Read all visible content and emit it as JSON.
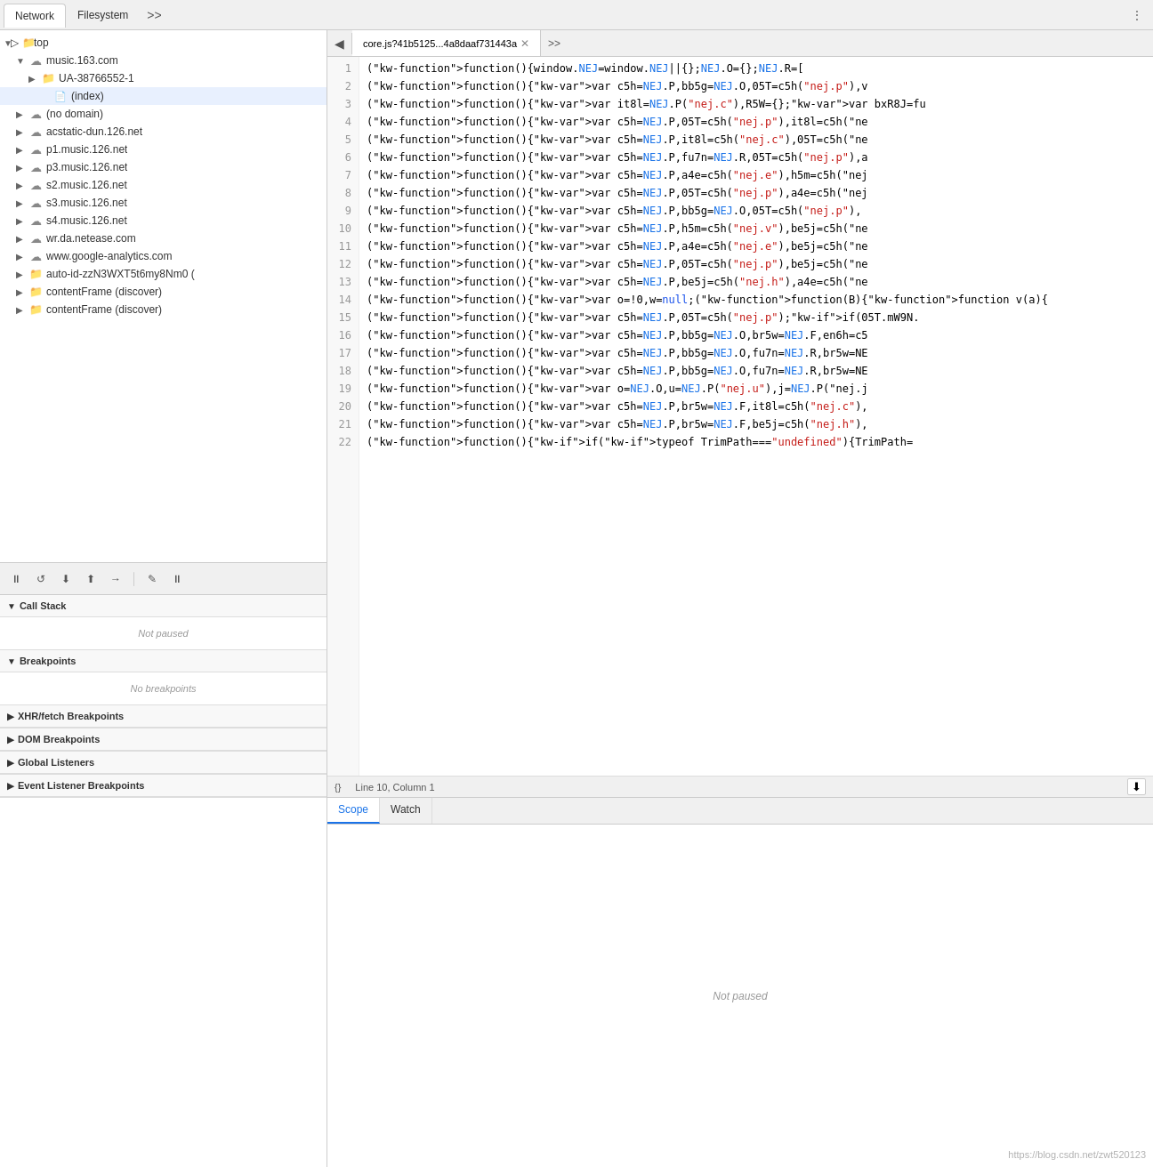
{
  "tabs": {
    "network_label": "Network",
    "filesystem_label": "Filesystem",
    "more_label": ">>",
    "dots": "⋮"
  },
  "file_tree": {
    "items": [
      {
        "id": "top",
        "label": "top",
        "indent": 0,
        "type": "arrow-folder",
        "expanded": true,
        "arrow": "▼"
      },
      {
        "id": "music163",
        "label": "music.163.com",
        "indent": 1,
        "type": "cloud",
        "expanded": true,
        "arrow": "▼"
      },
      {
        "id": "ua",
        "label": "UA-38766552-1",
        "indent": 2,
        "type": "folder",
        "expanded": false,
        "arrow": "▶"
      },
      {
        "id": "index",
        "label": "(index)",
        "indent": 3,
        "type": "file",
        "expanded": false,
        "arrow": "",
        "selected": true
      },
      {
        "id": "nodomain",
        "label": "(no domain)",
        "indent": 1,
        "type": "cloud",
        "expanded": false,
        "arrow": "▶"
      },
      {
        "id": "acstatic",
        "label": "acstatic-dun.126.net",
        "indent": 1,
        "type": "cloud",
        "expanded": false,
        "arrow": "▶"
      },
      {
        "id": "p1music",
        "label": "p1.music.126.net",
        "indent": 1,
        "type": "cloud",
        "expanded": false,
        "arrow": "▶"
      },
      {
        "id": "p3music",
        "label": "p3.music.126.net",
        "indent": 1,
        "type": "cloud",
        "expanded": false,
        "arrow": "▶"
      },
      {
        "id": "s2music",
        "label": "s2.music.126.net",
        "indent": 1,
        "type": "cloud",
        "expanded": false,
        "arrow": "▶"
      },
      {
        "id": "s3music",
        "label": "s3.music.126.net",
        "indent": 1,
        "type": "cloud",
        "expanded": false,
        "arrow": "▶"
      },
      {
        "id": "s4music",
        "label": "s4.music.126.net",
        "indent": 1,
        "type": "cloud",
        "expanded": false,
        "arrow": "▶"
      },
      {
        "id": "wrda",
        "label": "wr.da.netease.com",
        "indent": 1,
        "type": "cloud",
        "expanded": false,
        "arrow": "▶"
      },
      {
        "id": "google",
        "label": "www.google-analytics.com",
        "indent": 1,
        "type": "cloud",
        "expanded": false,
        "arrow": "▶"
      },
      {
        "id": "autoid",
        "label": "auto-id-zzN3WXT5t6my8Nm0 (",
        "indent": 1,
        "type": "folder",
        "expanded": false,
        "arrow": "▶"
      },
      {
        "id": "contentframe1",
        "label": "contentFrame (discover)",
        "indent": 1,
        "type": "folder",
        "expanded": false,
        "arrow": "▶"
      },
      {
        "id": "contentframe2",
        "label": "contentFrame (discover)",
        "indent": 1,
        "type": "folder",
        "expanded": false,
        "arrow": "▶"
      }
    ]
  },
  "debug": {
    "toolbar": {
      "pause_label": "⏸",
      "step_over_label": "↺",
      "step_into_label": "↓",
      "step_out_label": "↑",
      "continue_label": "→",
      "deactivate_label": "✎",
      "pause_on_exceptions_label": "⏸"
    },
    "sections": [
      {
        "id": "call-stack",
        "label": "Call Stack",
        "expanded": true,
        "arrow": "▼",
        "content": "Not paused",
        "empty": true
      },
      {
        "id": "breakpoints",
        "label": "Breakpoints",
        "expanded": true,
        "arrow": "▼",
        "content": "No breakpoints",
        "empty": true
      },
      {
        "id": "xhr-breakpoints",
        "label": "XHR/fetch Breakpoints",
        "expanded": false,
        "arrow": "▶",
        "content": "",
        "empty": false
      },
      {
        "id": "dom-breakpoints",
        "label": "DOM Breakpoints",
        "expanded": false,
        "arrow": "▶",
        "content": "",
        "empty": false
      },
      {
        "id": "global-listeners",
        "label": "Global Listeners",
        "expanded": false,
        "arrow": "▶",
        "content": "",
        "empty": false
      },
      {
        "id": "event-listeners",
        "label": "Event Listener Breakpoints",
        "expanded": false,
        "arrow": "▶",
        "content": "",
        "empty": false
      }
    ]
  },
  "code_editor": {
    "tab_label": "core.js?41b5125...4a8daaf731443a",
    "status": {
      "braces": "{}",
      "position": "Line 10, Column 1"
    },
    "lines": [
      {
        "num": 1,
        "text": "(function(){window.NEJ=window.NEJ||{};NEJ.O={};NEJ.R=["
      },
      {
        "num": 2,
        "text": "(function(){var c5h=NEJ.P,bb5g=NEJ.O,05T=c5h(\"nej.p\"),v"
      },
      {
        "num": 3,
        "text": "(function(){var it8l=NEJ.P(\"nej.c\"),R5W={};var bxR8J=fu"
      },
      {
        "num": 4,
        "text": "(function(){var c5h=NEJ.P,05T=c5h(\"nej.p\"),it8l=c5h(\"ne"
      },
      {
        "num": 5,
        "text": "(function(){var c5h=NEJ.P,it8l=c5h(\"nej.c\"),05T=c5h(\"ne"
      },
      {
        "num": 6,
        "text": "(function(){var c5h=NEJ.P,fu7n=NEJ.R,05T=c5h(\"nej.p\"),a"
      },
      {
        "num": 7,
        "text": "(function(){var c5h=NEJ.P,a4e=c5h(\"nej.e\"),h5m=c5h(\"nej"
      },
      {
        "num": 8,
        "text": "(function(){var c5h=NEJ.P,05T=c5h(\"nej.p\"),a4e=c5h(\"nej"
      },
      {
        "num": 9,
        "text": "(function(){var c5h=NEJ.P,bb5g=NEJ.O,05T=c5h(\"nej.p\"),"
      },
      {
        "num": 10,
        "text": "(function(){var c5h=NEJ.P,h5m=c5h(\"nej.v\"),be5j=c5h(\"ne"
      },
      {
        "num": 11,
        "text": "(function(){var c5h=NEJ.P,a4e=c5h(\"nej.e\"),be5j=c5h(\"ne"
      },
      {
        "num": 12,
        "text": "(function(){var c5h=NEJ.P,05T=c5h(\"nej.p\"),be5j=c5h(\"ne"
      },
      {
        "num": 13,
        "text": "(function(){var c5h=NEJ.P,be5j=c5h(\"nej.h\"),a4e=c5h(\"ne"
      },
      {
        "num": 14,
        "text": "(function(){var o=!0,w=null;(function(B){function v(a){"
      },
      {
        "num": 15,
        "text": "(function(){var c5h=NEJ.P,05T=c5h(\"nej.p\");if(05T.mW9N."
      },
      {
        "num": 16,
        "text": "(function(){var c5h=NEJ.P,bb5g=NEJ.O,br5w=NEJ.F,en6h=c5"
      },
      {
        "num": 17,
        "text": "(function(){var c5h=NEJ.P,bb5g=NEJ.O,fu7n=NEJ.R,br5w=NE"
      },
      {
        "num": 18,
        "text": "(function(){var c5h=NEJ.P,bb5g=NEJ.O,fu7n=NEJ.R,br5w=NE"
      },
      {
        "num": 19,
        "text": "(function(){var o=NEJ.O,u=NEJ.P(\"nej.u\"),j=NEJ.P(\"nej.j"
      },
      {
        "num": 20,
        "text": "(function(){var c5h=NEJ.P,br5w=NEJ.F,it8l=c5h(\"nej.c\"),"
      },
      {
        "num": 21,
        "text": "(function(){var c5h=NEJ.P,br5w=NEJ.F,be5j=c5h(\"nej.h\"),"
      },
      {
        "num": 22,
        "text": "(function(){if(typeof TrimPath===\"undefined\"){TrimPath="
      }
    ],
    "scope_tabs": [
      "Scope",
      "Watch"
    ],
    "active_scope_tab": "Scope",
    "not_paused_msg": "Not paused"
  },
  "watermark": "https://blog.csdn.net/zwt520123"
}
